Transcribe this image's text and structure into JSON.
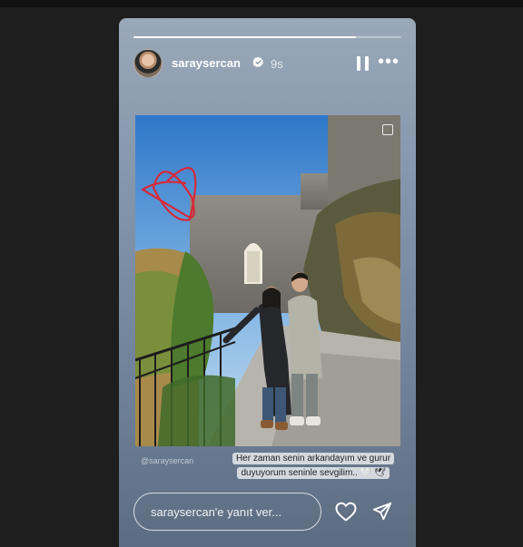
{
  "story": {
    "progress": 0.83,
    "username": "saraysercan",
    "verified": true,
    "timestamp": "9s",
    "more_icon": "•••",
    "watermark": "@saraysercan",
    "caption_lines": [
      "Her zaman senin arkandayım ve gurur",
      "duyuyorum seninle sevgilim.. 🤍 🕊"
    ]
  },
  "reply": {
    "placeholder": "saraysercan'e yanıt ver..."
  },
  "colors": {
    "heart_sticker": "#d62a3a",
    "accent": "#ffffff"
  },
  "icons": {
    "pause": "pause-icon",
    "more": "more-options-icon",
    "like": "heart-icon",
    "send": "send-icon"
  }
}
